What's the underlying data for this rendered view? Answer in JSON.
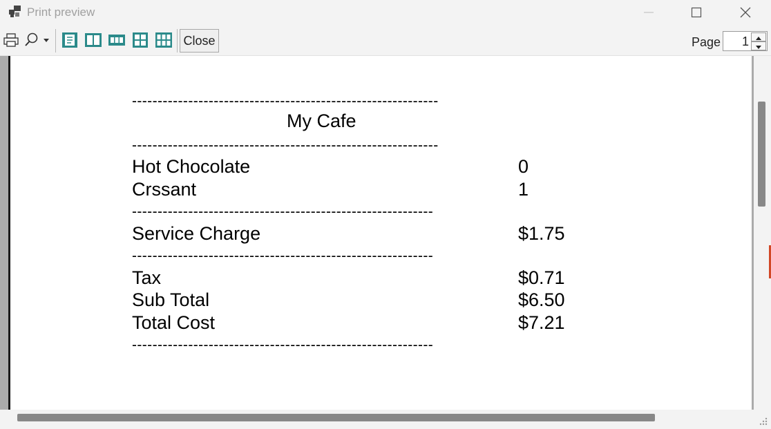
{
  "window": {
    "title": "Print preview"
  },
  "toolbar": {
    "print_icon": "printer-icon",
    "zoom_icon": "magnifier-icon",
    "layout_icons": [
      "one-page-icon",
      "two-pages-icon",
      "three-pages-icon",
      "four-pages-icon",
      "six-pages-icon"
    ],
    "close_label": "Close",
    "page_label": "Page",
    "page_value": "1"
  },
  "receipt": {
    "dash_long": "------------------------------------------------------------",
    "dash_short": "-----------------------------------------------------------",
    "title": "My Cafe",
    "items": [
      {
        "name": "Hot Chocolate",
        "value": "0"
      },
      {
        "name": "Crssant",
        "value": "1"
      }
    ],
    "service": {
      "name": "Service Charge",
      "value": "$1.75"
    },
    "totals": [
      {
        "name": "Tax",
        "value": "$0.71"
      },
      {
        "name": "Sub Total",
        "value": "$6.50"
      },
      {
        "name": "Total Cost",
        "value": "$7.21"
      }
    ]
  },
  "colors": {
    "toolbar_icon": "#2b8a8a",
    "chrome": "#f3f3f3",
    "scroll_thumb": "#888888"
  }
}
